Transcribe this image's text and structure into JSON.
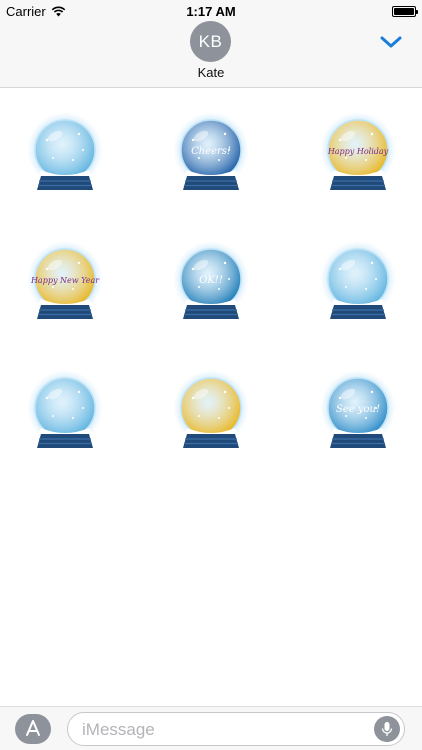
{
  "status_bar": {
    "carrier": "Carrier",
    "time": "1:17 AM"
  },
  "header": {
    "avatar_initials": "KB",
    "contact_name": "Kate"
  },
  "stickers": [
    {
      "name": "snowmen",
      "globe": "#5fb4e0",
      "text": ""
    },
    {
      "name": "cheers",
      "globe": "#1f5fa8",
      "text": "Cheers!"
    },
    {
      "name": "happy-holiday",
      "globe": "#e8b623",
      "text": "Happy Holiday"
    },
    {
      "name": "happy-new-year",
      "globe": "#e8b623",
      "text": "Happy New Year"
    },
    {
      "name": "ok-bear",
      "globe": "#1e7cb8",
      "text": "OK!!"
    },
    {
      "name": "polar-bear",
      "globe": "#5fb4e0",
      "text": ""
    },
    {
      "name": "skier",
      "globe": "#5fb4e0",
      "text": ""
    },
    {
      "name": "couple-gift",
      "globe": "#e8b623",
      "text": ""
    },
    {
      "name": "see-you",
      "globe": "#2c8cc8",
      "text": "See you!"
    }
  ],
  "input": {
    "placeholder": "iMessage"
  },
  "colors": {
    "accent": "#1a7dd7",
    "gray": "#8e939b",
    "base": "#1f4a7a"
  }
}
